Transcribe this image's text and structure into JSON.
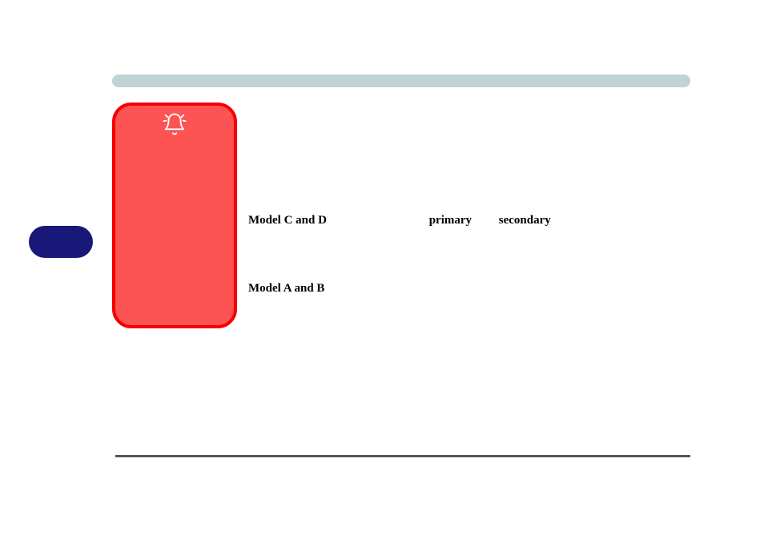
{
  "top_bar": {},
  "blue_pill": {},
  "red_card": {
    "icon": "bell"
  },
  "text_rows": {
    "row1": {
      "model": "Model C and D",
      "primary": "primary",
      "secondary": "secondary"
    },
    "row2": {
      "model": "Model A and B"
    }
  }
}
